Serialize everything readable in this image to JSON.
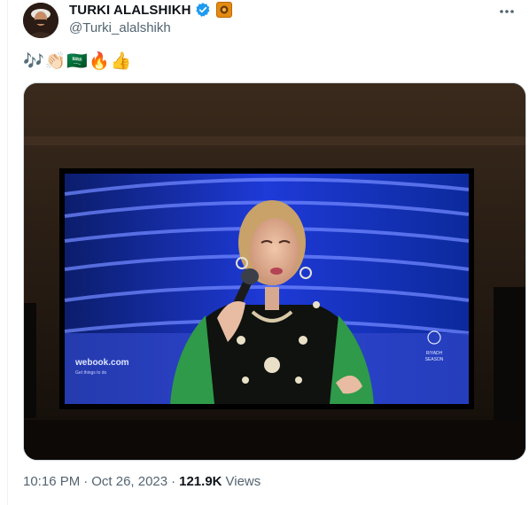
{
  "author": {
    "display_name": "TURKI ALALSHIKH",
    "handle": "@Turki_alalshikh"
  },
  "post": {
    "text_emojis": [
      "🎶",
      "👏🏻",
      "🇸🇦",
      "🔥",
      "👍"
    ]
  },
  "media": {
    "screen_text_left": "webook.com",
    "screen_text_left_sub": "Get things to do",
    "screen_text_right_1": "RIYADH",
    "screen_text_right_2": "SEASON"
  },
  "meta": {
    "time": "10:16 PM",
    "separator": "·",
    "date": "Oct 26, 2023",
    "views_count": "121.9K",
    "views_label": "Views"
  },
  "colors": {
    "verified_blue": "#1d9bf0",
    "affiliate_gold": "#e38b12",
    "secondary_text": "#536471"
  },
  "icons": {
    "verified": "verified-badge-icon",
    "affiliate": "affiliate-badge-icon",
    "more": "more-options-icon"
  }
}
